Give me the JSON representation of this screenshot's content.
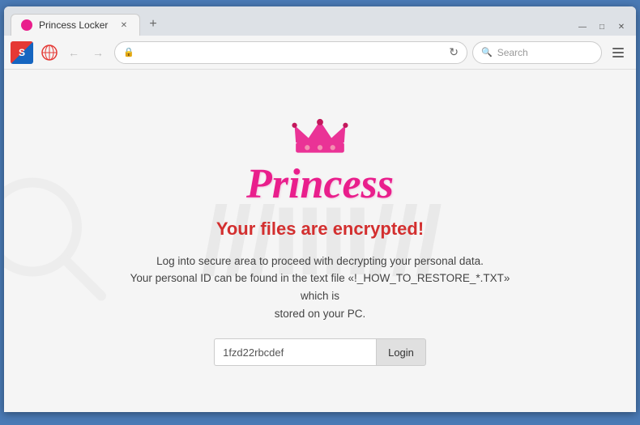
{
  "browser": {
    "tab": {
      "title": "Princess Locker",
      "favicon_color": "#e91e8c"
    },
    "window_controls": {
      "minimize": "—",
      "maximize": "□",
      "close": "✕"
    },
    "nav": {
      "back_disabled": true,
      "forward_disabled": true,
      "refresh_label": "↻",
      "search_placeholder": "Search",
      "menu_label": "≡"
    },
    "address": {
      "lock_icon": "🔒",
      "url": ""
    }
  },
  "page": {
    "logo": {
      "princess_label": "Princess"
    },
    "heading": "Your files are encrypted!",
    "description_line1": "Log into secure area to proceed with decrypting your personal data.",
    "description_line2": "Your personal ID can be found in the text file «!_HOW_TO_RESTORE_*.TXT» which is",
    "description_line3": "stored on your PC.",
    "form": {
      "id_value": "1fzd22rbcdef",
      "id_placeholder": "1fzd22rbcdef",
      "login_label": "Login"
    }
  },
  "watermark": {
    "text": "///IIII///"
  }
}
